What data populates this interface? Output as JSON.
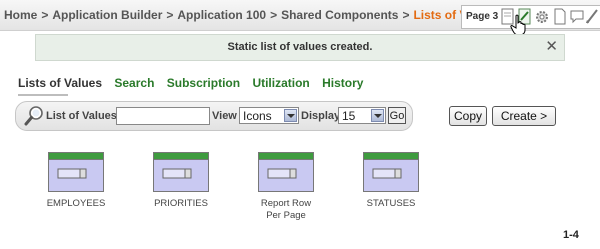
{
  "breadcrumb": {
    "items": [
      "Home",
      "Application Builder",
      "Application 100",
      "Shared Components"
    ],
    "current": "Lists of Values",
    "separator": ">"
  },
  "toolbar": {
    "page_label": "Page 3",
    "icons": [
      "edit-page-icon",
      "create-icon",
      "settings-icon",
      "export-icon",
      "comments-icon",
      "developer-icon"
    ]
  },
  "message": {
    "text": "Static list of values created.",
    "close": "✕"
  },
  "tabs": [
    "Lists of Values",
    "Search",
    "Subscription",
    "Utilization",
    "History"
  ],
  "search": {
    "label": "List of Values",
    "value": "",
    "view_label": "View",
    "view_value": "Icons",
    "display_label": "Display",
    "display_value": "15",
    "go_label": "Go"
  },
  "actions": {
    "copy_label": "Copy",
    "create_label": "Create >"
  },
  "lovs": [
    {
      "name": "EMPLOYEES"
    },
    {
      "name": "PRIORITIES"
    },
    {
      "name": "Report Row Per Page"
    },
    {
      "name": "STATUSES"
    }
  ],
  "pagination": "1-4",
  "colors": {
    "current_crumb": "#e36b12",
    "tab_link": "#2a7a2a",
    "icon_header": "#3f9b3f",
    "icon_body": "#c9c9f2"
  }
}
